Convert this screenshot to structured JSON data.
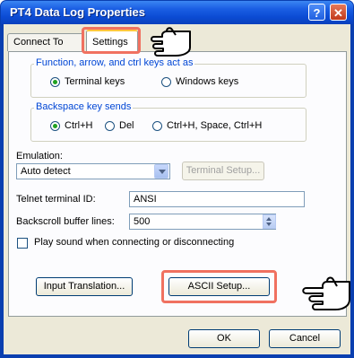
{
  "window": {
    "title": "PT4 Data Log Properties",
    "help_glyph": "?",
    "close_glyph": "✕"
  },
  "tabs": [
    {
      "label": "Connect To"
    },
    {
      "label": "Settings"
    }
  ],
  "function_group": {
    "label": "Function, arrow, and ctrl keys act as",
    "options": [
      {
        "label": "Terminal keys",
        "selected": true
      },
      {
        "label": "Windows keys",
        "selected": false
      }
    ]
  },
  "backspace_group": {
    "label": "Backspace key sends",
    "options": [
      {
        "label": "Ctrl+H",
        "selected": true
      },
      {
        "label": "Del",
        "selected": false
      },
      {
        "label": "Ctrl+H, Space, Ctrl+H",
        "selected": false
      }
    ]
  },
  "emulation": {
    "label": "Emulation:",
    "value": "Auto detect",
    "setup_button": "Terminal Setup..."
  },
  "telnet": {
    "label": "Telnet terminal ID:",
    "value": "ANSI"
  },
  "backscroll": {
    "label": "Backscroll buffer lines:",
    "value": "500"
  },
  "play_sound": {
    "label": "Play sound when connecting or disconnecting",
    "checked": false
  },
  "buttons": {
    "input_translation": "Input Translation...",
    "ascii_setup": "ASCII Setup...",
    "ok": "OK",
    "cancel": "Cancel"
  },
  "icons": {
    "pointer": "pointing-hand-icon"
  },
  "colors": {
    "title_bar": "#0b4bd3",
    "highlight": "#f07160",
    "group_label": "#0046d5",
    "dialog_bg": "#ece9d8"
  }
}
